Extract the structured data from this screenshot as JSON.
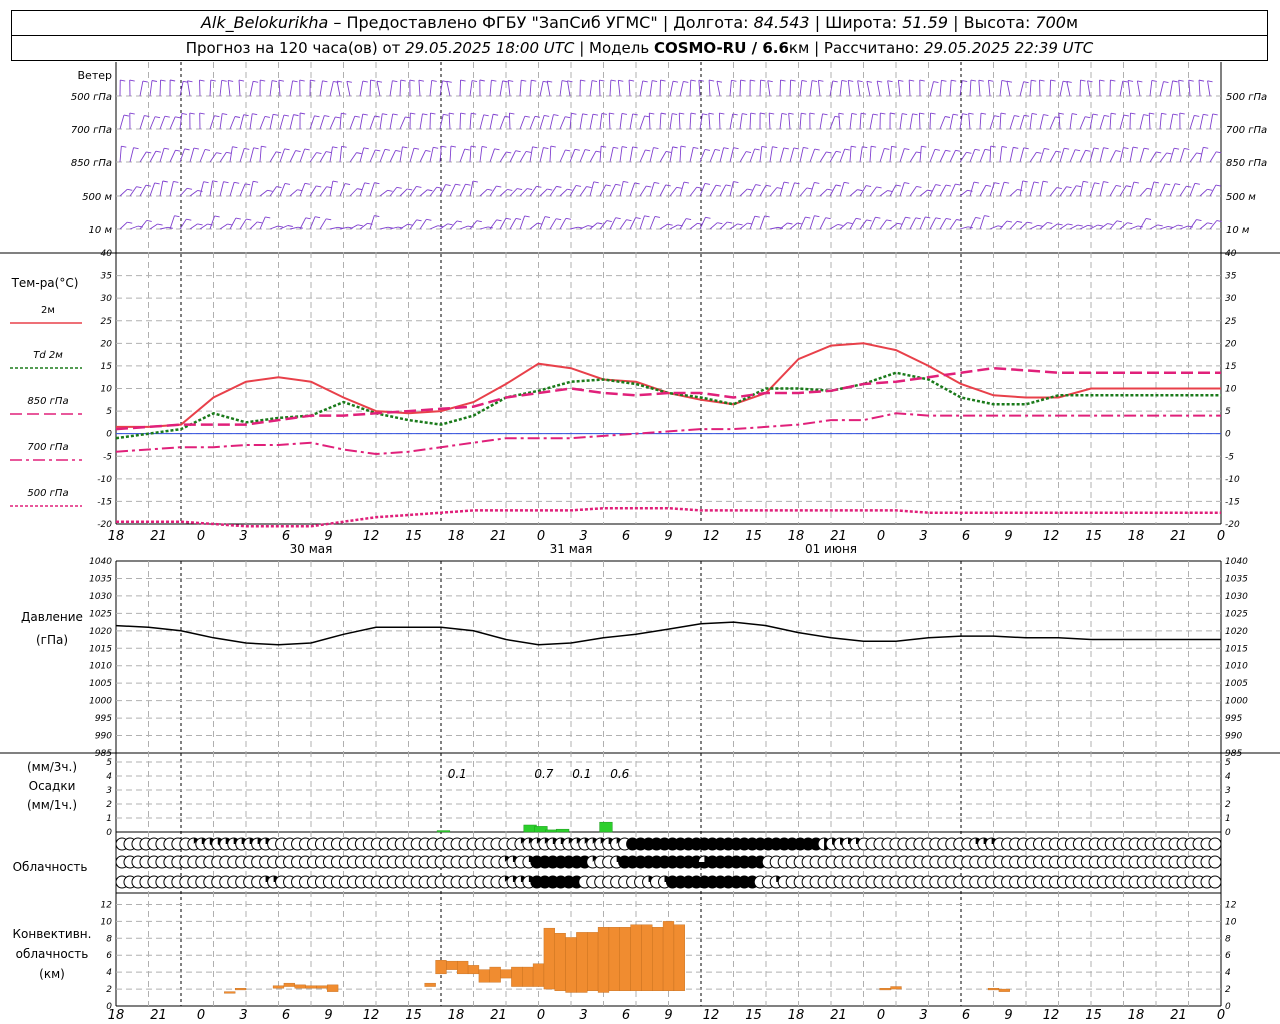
{
  "header": {
    "station": "Alk_Belokurikha",
    "provider": "– Предоставлено ФГБУ \"ЗапСиб УГМС\"",
    "lon_label": "| Долгота:",
    "lon": "84.543",
    "lat_label": "| Широта:",
    "lat": "51.59",
    "alt_label": "| Высота:",
    "alt": "700",
    "alt_unit": "м",
    "forecast_label": "Прогноз на 120 часа(ов) от",
    "forecast_time": "29.05.2025 18:00 UTC",
    "model_label": "| Модель",
    "model": "COSMO-RU / 6.6",
    "model_unit": "км",
    "calc_label": "| Рассчитано:",
    "calc_time": "29.05.2025 22:39 UTC"
  },
  "colors": {
    "wind": "#7f3fcf",
    "t2m": "#e8404a",
    "td2m": "#1a7a1a",
    "t850": "#e0207a",
    "t700": "#e0207a",
    "t500": "#e0207a",
    "pressure": "#000000",
    "precip": "#2ccf2c",
    "convective": "#f08c30",
    "grid": "#b0b0b0"
  },
  "chart_data": [
    {
      "type": "barbs",
      "title": "Ветер",
      "levels": [
        "500 гПа",
        "700 гПа",
        "850 гПа",
        "500 м",
        "10  м"
      ]
    },
    {
      "type": "line",
      "ylabel": "Тем-ра(°С)",
      "ylim": [
        -20,
        40
      ],
      "yticks": [
        -20,
        -15,
        -10,
        -5,
        0,
        5,
        10,
        15,
        20,
        25,
        30,
        35,
        40
      ],
      "xlim": [
        -6,
        96
      ],
      "x_tick_labels": [
        "18",
        "21",
        "0",
        "3",
        "6",
        "9",
        "12",
        "15",
        "18",
        "21",
        "0",
        "3",
        "6",
        "9",
        "12",
        "15",
        "18",
        "21",
        "0",
        "3",
        "6",
        "9",
        "12",
        "15",
        "18",
        "21",
        "0"
      ],
      "date_labels": [
        "30 мая",
        "31 мая",
        "01 июня"
      ],
      "legend": [
        {
          "label": "2м",
          "series": "t2m"
        },
        {
          "label": "Td  2м",
          "series": "td2m"
        },
        {
          "label": "850 гПа",
          "series": "t850"
        },
        {
          "label": "700 гПа",
          "series": "t700"
        },
        {
          "label": "500 гПа",
          "series": "t500"
        }
      ],
      "x": [
        -6,
        -3,
        0,
        3,
        6,
        9,
        12,
        15,
        18,
        21,
        24,
        27,
        30,
        33,
        36,
        39,
        42,
        45,
        48,
        51,
        54,
        57,
        60,
        63,
        66,
        69,
        72,
        75,
        78,
        81,
        84,
        87,
        90,
        93,
        96
      ],
      "series": [
        {
          "key": "t2m",
          "values": [
            1.5,
            1.5,
            2,
            8,
            11.5,
            12.5,
            11.5,
            8,
            5,
            4.5,
            5,
            7,
            11,
            15.5,
            14.5,
            12,
            11.5,
            9,
            7.5,
            6.5,
            9,
            16.5,
            19.5,
            20,
            18.5,
            15,
            11,
            8.5,
            8,
            8,
            10,
            10,
            10,
            10,
            10
          ]
        },
        {
          "key": "td2m",
          "values": [
            -1,
            0,
            1,
            4.5,
            2.5,
            3.5,
            4,
            7,
            4.5,
            3,
            2,
            4,
            8,
            9.5,
            11.5,
            12,
            11,
            9,
            8,
            6.5,
            10,
            10,
            9.5,
            11,
            13.5,
            12,
            8,
            6.5,
            6.5,
            8.5,
            8.5,
            8.5,
            8.5,
            8.5,
            8.5
          ]
        },
        {
          "key": "t850",
          "values": [
            1,
            1.5,
            2,
            2,
            2,
            3,
            4,
            4,
            4.5,
            5,
            5.5,
            6,
            8,
            9,
            10,
            9,
            8.5,
            9,
            9,
            8,
            9,
            9,
            9.5,
            11,
            11.5,
            12.5,
            13.5,
            14.5,
            14,
            13.5,
            13.5,
            13.5,
            13.5,
            13.5,
            13.5
          ]
        },
        {
          "key": "t700",
          "values": [
            -4,
            -3.5,
            -3,
            -3,
            -2.5,
            -2.5,
            -2,
            -3.5,
            -4.5,
            -4,
            -3,
            -2,
            -1,
            -1,
            -1,
            -0.5,
            0,
            0.5,
            1,
            1,
            1.5,
            2,
            3,
            3,
            4.5,
            4,
            4,
            4,
            4,
            4,
            4,
            4,
            4,
            4,
            4
          ]
        },
        {
          "key": "t500",
          "values": [
            -19.5,
            -19.5,
            -19.5,
            -20,
            -20.5,
            -20.5,
            -20.5,
            -19.5,
            -18.5,
            -18,
            -17.5,
            -17,
            -17,
            -17,
            -17,
            -16.5,
            -16.5,
            -16.5,
            -17,
            -17,
            -17,
            -17,
            -17,
            -17,
            -17,
            -17.5,
            -17.5,
            -17.5,
            -17.5,
            -17.5,
            -17.5,
            -17.5,
            -17.5,
            -17.5,
            -17.5
          ]
        }
      ]
    },
    {
      "type": "line",
      "ylabel": "Давление",
      "yunit": "(гПа)",
      "ylim": [
        985,
        1040
      ],
      "yticks": [
        985,
        990,
        995,
        1000,
        1005,
        1010,
        1015,
        1020,
        1025,
        1030,
        1035,
        1040
      ],
      "x": [
        -6,
        -3,
        0,
        3,
        6,
        9,
        12,
        15,
        18,
        21,
        24,
        27,
        30,
        33,
        36,
        39,
        42,
        45,
        48,
        51,
        54,
        57,
        60,
        63,
        66,
        69,
        72,
        75,
        78,
        81,
        84,
        87,
        90,
        93,
        96
      ],
      "values": [
        1021.5,
        1021,
        1020,
        1018,
        1016.5,
        1016,
        1016.5,
        1019,
        1021,
        1021,
        1021,
        1020,
        1017.5,
        1016,
        1016.5,
        1018,
        1019,
        1020.5,
        1022,
        1022.5,
        1021.5,
        1019.5,
        1018,
        1017,
        1017,
        1018,
        1018.5,
        1018.5,
        1018,
        1018,
        1017.5,
        1017.5,
        1017.5,
        1017.5,
        1017.5
      ]
    },
    {
      "type": "bar",
      "ylabel": "Осадки",
      "yunit_3h": "(мм/3ч.)",
      "yunit_1h": "(мм/1ч.)",
      "ylim": [
        0,
        5
      ],
      "yticks": [
        0,
        1,
        2,
        3,
        4,
        5
      ],
      "x": [
        24,
        32,
        33,
        34,
        35,
        39
      ],
      "values": [
        0.1,
        0.5,
        0.4,
        0.15,
        0.2,
        0.7
      ],
      "labels": [
        {
          "x": 25.5,
          "text": "0.1"
        },
        {
          "x": 33.5,
          "text": "0.7"
        },
        {
          "x": 37,
          "text": "0.1"
        },
        {
          "x": 40.5,
          "text": "0.6"
        }
      ]
    },
    {
      "type": "table",
      "ylabel": "Облачность",
      "x_start": -6,
      "x_step": 1.5,
      "rows": [
        "000000000123322222200000000000000000000000000000001111221111121088888888888888888888888843322000000000000002220000000000000000000000000000",
        "000000000000000000000000000000000000000000000000120288888881002888888888868888888000000000000000000000000000000000000000000000000000000000",
        "000000000000000000220000000000000000000000000000122288888800000000202888888888880020000000000000000000000000000000000000000000000000000000"
      ]
    },
    {
      "type": "bar",
      "ylabel": "Конвективн.",
      "ylabel2": "облачность",
      "yunit": "(км)",
      "ylim": [
        0,
        13
      ],
      "yticks": [
        0,
        2,
        4,
        6,
        8,
        10,
        12
      ],
      "bars": [
        {
          "x": 4.5,
          "bottom": 1.5,
          "top": 1.7
        },
        {
          "x": 5.5,
          "bottom": 1.9,
          "top": 2.1
        },
        {
          "x": 9,
          "bottom": 2.1,
          "top": 2.4
        },
        {
          "x": 10,
          "bottom": 2.3,
          "top": 2.7
        },
        {
          "x": 11,
          "bottom": 2.1,
          "top": 2.5
        },
        {
          "x": 12,
          "bottom": 2.1,
          "top": 2.4
        },
        {
          "x": 13,
          "bottom": 2.1,
          "top": 2.4
        },
        {
          "x": 14,
          "bottom": 1.7,
          "top": 2.5
        },
        {
          "x": 23,
          "bottom": 2.3,
          "top": 2.7
        },
        {
          "x": 24,
          "bottom": 3.8,
          "top": 5.4
        },
        {
          "x": 25,
          "bottom": 4.3,
          "top": 5.3
        },
        {
          "x": 26,
          "bottom": 3.8,
          "top": 5.3
        },
        {
          "x": 27,
          "bottom": 3.8,
          "top": 4.8
        },
        {
          "x": 28,
          "bottom": 2.8,
          "top": 4.3
        },
        {
          "x": 29,
          "bottom": 2.8,
          "top": 4.6
        },
        {
          "x": 30,
          "bottom": 3.3,
          "top": 4.3
        },
        {
          "x": 31,
          "bottom": 2.3,
          "top": 4.6
        },
        {
          "x": 32,
          "bottom": 2.3,
          "top": 4.6
        },
        {
          "x": 33,
          "bottom": 2.3,
          "top": 5.0
        },
        {
          "x": 34,
          "bottom": 2.0,
          "top": 9.2
        },
        {
          "x": 35,
          "bottom": 1.8,
          "top": 8.6
        },
        {
          "x": 36,
          "bottom": 1.6,
          "top": 8.1
        },
        {
          "x": 37,
          "bottom": 1.6,
          "top": 8.7
        },
        {
          "x": 38,
          "bottom": 1.8,
          "top": 8.7
        },
        {
          "x": 39,
          "bottom": 1.6,
          "top": 9.3
        },
        {
          "x": 40,
          "bottom": 1.8,
          "top": 9.3
        },
        {
          "x": 41,
          "bottom": 1.8,
          "top": 9.3
        },
        {
          "x": 42,
          "bottom": 1.8,
          "top": 9.6
        },
        {
          "x": 43,
          "bottom": 1.8,
          "top": 9.6
        },
        {
          "x": 44,
          "bottom": 1.8,
          "top": 9.3
        },
        {
          "x": 45,
          "bottom": 1.8,
          "top": 10.0
        },
        {
          "x": 46,
          "bottom": 1.8,
          "top": 9.6
        },
        {
          "x": 65,
          "bottom": 1.9,
          "top": 2.1
        },
        {
          "x": 66,
          "bottom": 2.0,
          "top": 2.3
        },
        {
          "x": 75,
          "bottom": 1.9,
          "top": 2.1
        },
        {
          "x": 76,
          "bottom": 1.7,
          "top": 2.0
        }
      ]
    }
  ]
}
